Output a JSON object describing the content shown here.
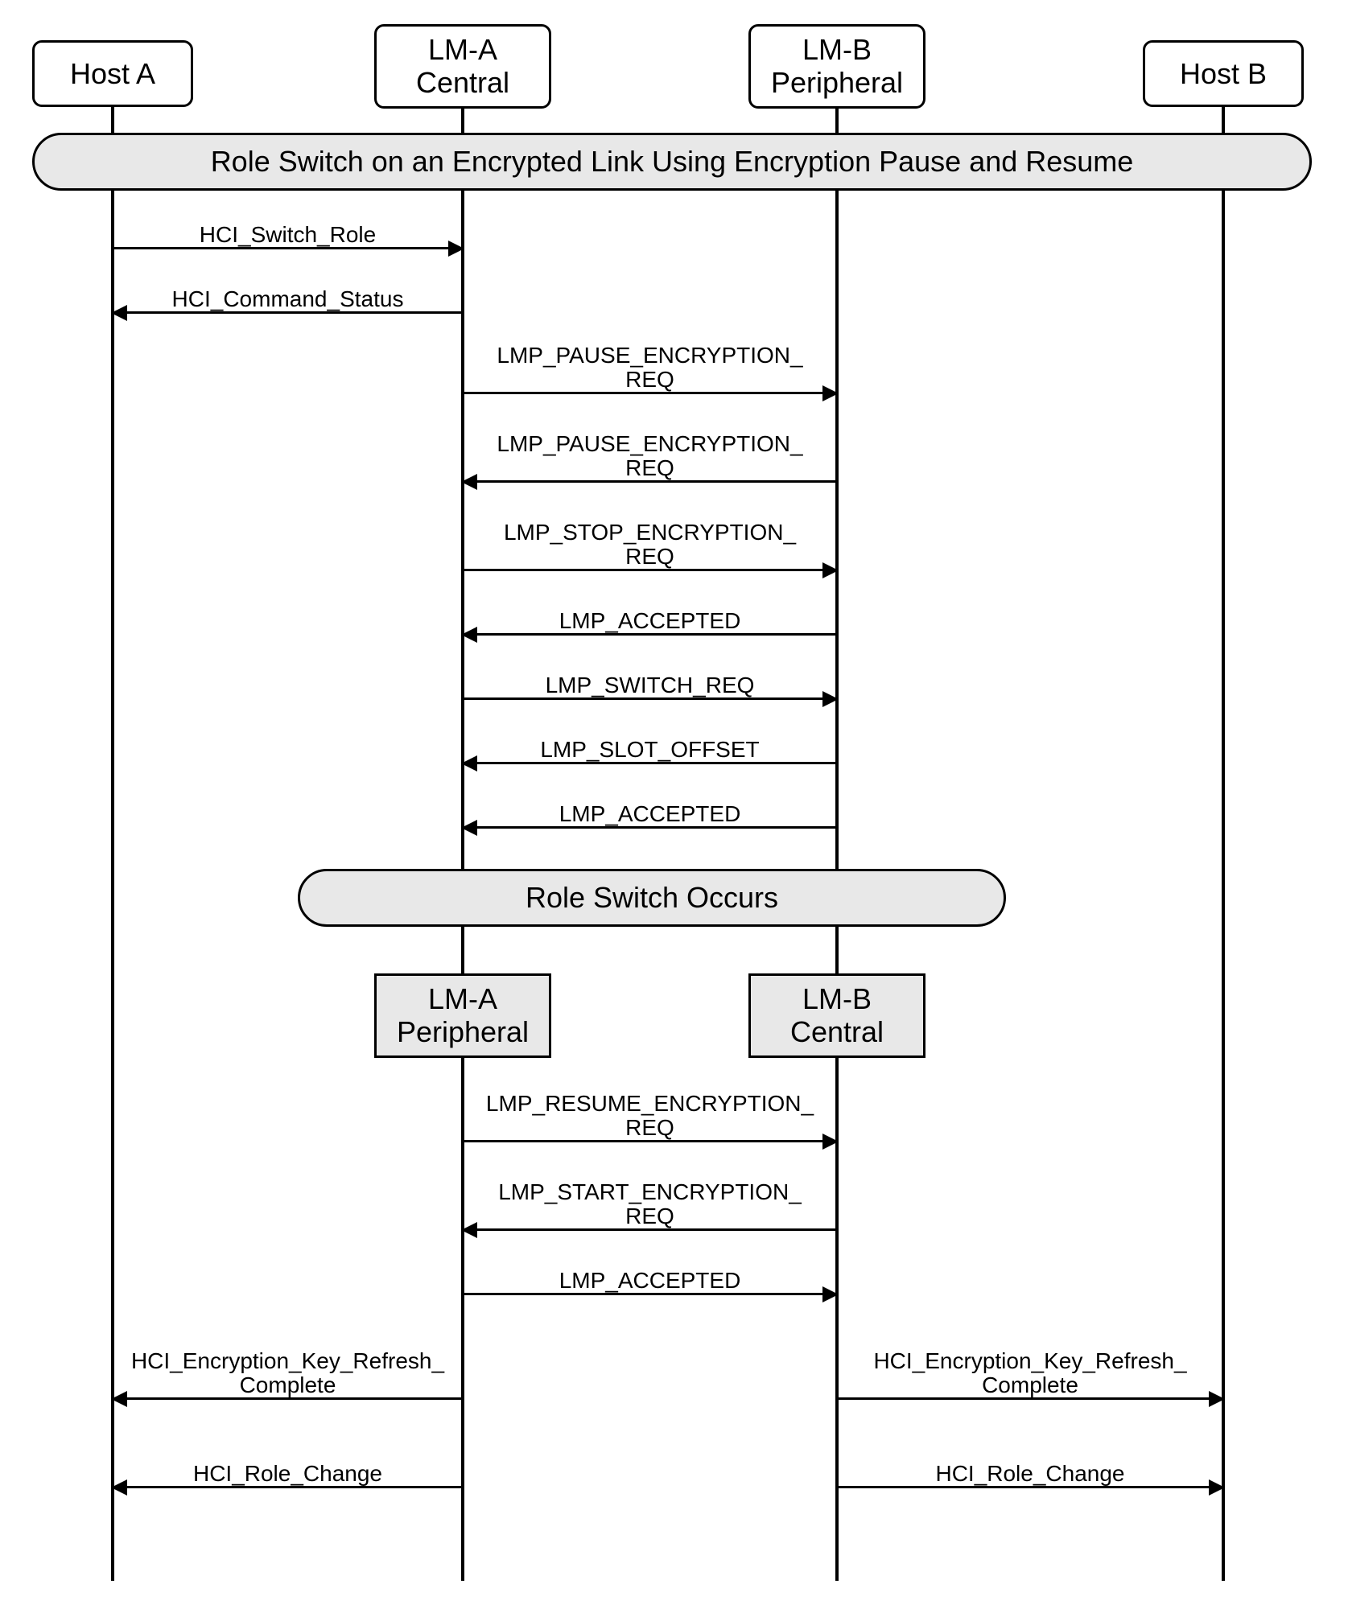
{
  "actors": {
    "hostA": "Host A",
    "lmA": "LM-A\nCentral",
    "lmB": "LM-B\nPeripheral",
    "hostB": "Host B"
  },
  "phases": {
    "title": "Role Switch on an Encrypted Link Using Encryption Pause and Resume",
    "switch": "Role Switch Occurs"
  },
  "roles_after": {
    "lmA": "LM-A\nPeripheral",
    "lmB": "LM-B\nCentral"
  },
  "messages": [
    {
      "id": "m1",
      "label": "HCI_Switch_Role",
      "from": "hostA",
      "to": "lmA",
      "dir": "r"
    },
    {
      "id": "m2",
      "label": "HCI_Command_Status",
      "from": "lmA",
      "to": "hostA",
      "dir": "l"
    },
    {
      "id": "m3",
      "label": "LMP_PAUSE_ENCRYPTION_\nREQ",
      "from": "lmA",
      "to": "lmB",
      "dir": "r"
    },
    {
      "id": "m4",
      "label": "LMP_PAUSE_ENCRYPTION_\nREQ",
      "from": "lmB",
      "to": "lmA",
      "dir": "l"
    },
    {
      "id": "m5",
      "label": "LMP_STOP_ENCRYPTION_\nREQ",
      "from": "lmA",
      "to": "lmB",
      "dir": "r"
    },
    {
      "id": "m6",
      "label": "LMP_ACCEPTED",
      "from": "lmB",
      "to": "lmA",
      "dir": "l"
    },
    {
      "id": "m7",
      "label": "LMP_SWITCH_REQ",
      "from": "lmA",
      "to": "lmB",
      "dir": "r"
    },
    {
      "id": "m8",
      "label": "LMP_SLOT_OFFSET",
      "from": "lmB",
      "to": "lmA",
      "dir": "l"
    },
    {
      "id": "m9",
      "label": "LMP_ACCEPTED",
      "from": "lmB",
      "to": "lmA",
      "dir": "l"
    },
    {
      "id": "m10",
      "label": "LMP_RESUME_ENCRYPTION_\nREQ",
      "from": "lmA",
      "to": "lmB",
      "dir": "r"
    },
    {
      "id": "m11",
      "label": "LMP_START_ENCRYPTION_\nREQ",
      "from": "lmB",
      "to": "lmA",
      "dir": "l"
    },
    {
      "id": "m12",
      "label": "LMP_ACCEPTED",
      "from": "lmA",
      "to": "lmB",
      "dir": "r"
    },
    {
      "id": "m13",
      "label": "HCI_Encryption_Key_Refresh_\nComplete",
      "from": "lmA",
      "to": "hostA",
      "dir": "l"
    },
    {
      "id": "m14",
      "label": "HCI_Encryption_Key_Refresh_\nComplete",
      "from": "lmB",
      "to": "hostB",
      "dir": "r"
    },
    {
      "id": "m15",
      "label": "HCI_Role_Change",
      "from": "lmA",
      "to": "hostA",
      "dir": "l"
    },
    {
      "id": "m16",
      "label": "HCI_Role_Change",
      "from": "lmB",
      "to": "hostB",
      "dir": "r"
    }
  ],
  "layout": {
    "x": {
      "hostA": 120,
      "lmA": 555,
      "lmB": 1020,
      "hostB": 1500
    },
    "msgY": {
      "m1": 290,
      "m2": 370,
      "m3": 470,
      "m4": 580,
      "m5": 690,
      "m6": 770,
      "m7": 850,
      "m8": 930,
      "m9": 1010,
      "m10": 1400,
      "m11": 1510,
      "m12": 1590,
      "m13": 1720,
      "m14": 1720,
      "m15": 1830,
      "m16": 1830
    }
  }
}
